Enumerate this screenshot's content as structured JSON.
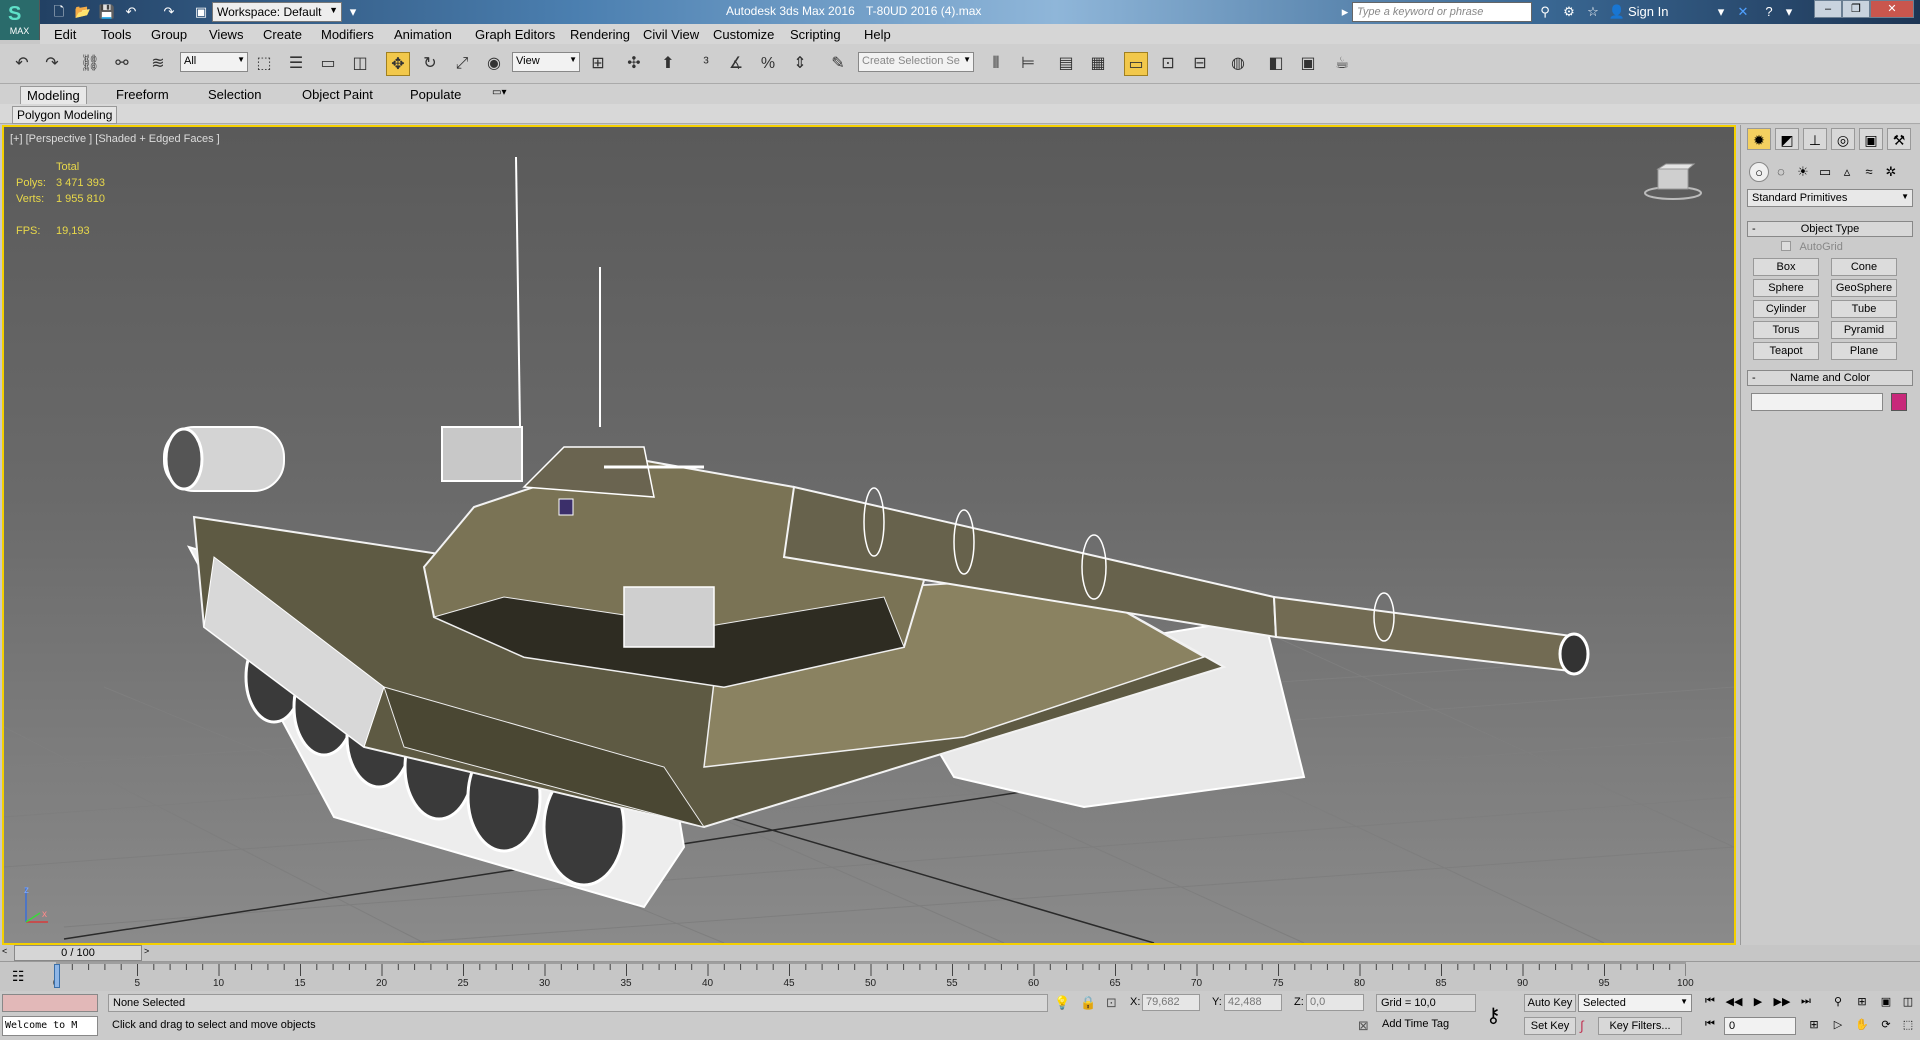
{
  "titlebar": {
    "logo_text": "MAX",
    "workspace_label": "Workspace: Default",
    "app_title": "Autodesk 3ds Max 2016",
    "file_title": "T-80UD 2016 (4).max",
    "search_placeholder": "Type a keyword or phrase",
    "signin_label": "Sign In"
  },
  "menu": {
    "items": [
      "Edit",
      "Tools",
      "Group",
      "Views",
      "Create",
      "Modifiers",
      "Animation",
      "Graph Editors",
      "Rendering",
      "Civil View",
      "Customize",
      "Scripting",
      "Help"
    ]
  },
  "toolbar": {
    "selection_filter": "All",
    "ref_coord": "View",
    "selection_set_placeholder": "Create Selection Se"
  },
  "ribbon": {
    "tabs": [
      "Modeling",
      "Freeform",
      "Selection",
      "Object Paint",
      "Populate"
    ],
    "active_tab": "Modeling",
    "panel_label": "Polygon Modeling"
  },
  "viewport": {
    "label": "[+] [Perspective ] [Shaded + Edged Faces ]",
    "stats": {
      "total_label": "Total",
      "polys_label": "Polys:",
      "polys_value": "3 471 393",
      "verts_label": "Verts:",
      "verts_value": "1 955 810",
      "fps_label": "FPS:",
      "fps_value": "19,193"
    },
    "axis": {
      "z": "z",
      "x": "x"
    },
    "active_border_color": "#f4d000"
  },
  "command_panel": {
    "primitive_type": "Standard Primitives",
    "object_type_title": "Object Type",
    "autogrid_label": "AutoGrid",
    "buttons": [
      "Box",
      "Cone",
      "Sphere",
      "GeoSphere",
      "Cylinder",
      "Tube",
      "Torus",
      "Pyramid",
      "Teapot",
      "Plane"
    ],
    "name_color_title": "Name and Color",
    "object_color": "#c8287a"
  },
  "timeline": {
    "frame_counter": "0 / 100",
    "ticks": [
      "0",
      "5",
      "10",
      "15",
      "20",
      "25",
      "30",
      "35",
      "40",
      "45",
      "50",
      "55",
      "60",
      "65",
      "70",
      "75",
      "80",
      "85",
      "90",
      "95",
      "100"
    ]
  },
  "status": {
    "listener_text": "Welcome to M",
    "selection_status": "None Selected",
    "prompt": "Click and drag to select and move objects",
    "x_label": "X:",
    "x_value": "79,682",
    "y_label": "Y:",
    "y_value": "42,488",
    "z_label": "Z:",
    "z_value": "0,0",
    "grid": "Grid = 10,0",
    "add_time_tag": "Add Time Tag",
    "auto_key": "Auto Key",
    "set_key": "Set Key",
    "key_mode": "Selected",
    "key_filters": "Key Filters...",
    "current_frame": "0"
  }
}
